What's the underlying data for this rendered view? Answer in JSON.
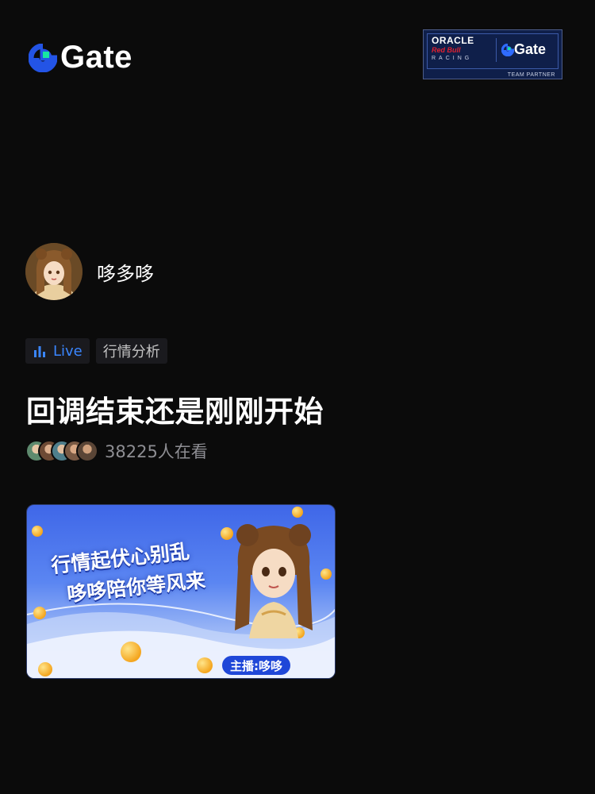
{
  "brand": {
    "name": "Gate",
    "color": "#2354e6",
    "accent": "#17e6a1"
  },
  "partner": {
    "line1": "ORACLE",
    "line2": "Red Bull",
    "line3": "RACING",
    "brand": "Gate",
    "caption": "TEAM PARTNER"
  },
  "host": {
    "name": "哆多哆",
    "avatar_icon": "avatar-girl"
  },
  "tags": {
    "live_label": "Live",
    "topic_label": "行情分析"
  },
  "stream": {
    "title": "回调结束还是刚刚开始"
  },
  "viewers": {
    "count_text": "38225人在看"
  },
  "banner": {
    "line1": "行情起伏心别乱",
    "line2": "哆哆陪你等风来",
    "anchor_label": "主播:哆哆"
  }
}
